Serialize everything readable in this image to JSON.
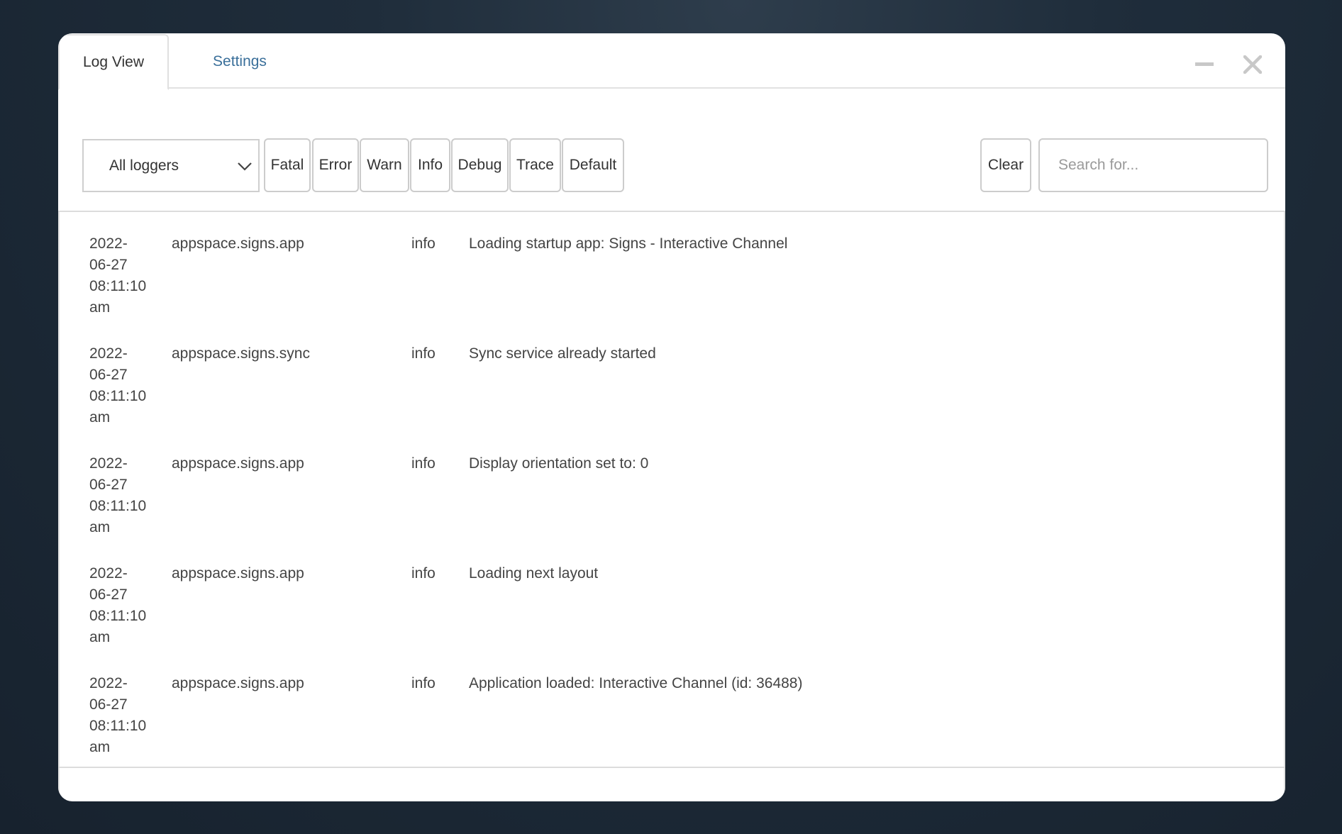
{
  "tabs": {
    "log_view": "Log View",
    "settings": "Settings"
  },
  "window_controls": [
    "minimize-icon",
    "close-icon"
  ],
  "toolbar": {
    "logger_select": "All loggers",
    "levels": [
      "Fatal",
      "Error",
      "Warn",
      "Info",
      "Debug",
      "Trace",
      "Default"
    ],
    "clear": "Clear",
    "search_placeholder": "Search for..."
  },
  "logs": [
    {
      "date": "2022-",
      "date2": "06-27",
      "time": "08:11:10",
      "ampm": "am",
      "logger": "appspace.signs.app",
      "level": "info",
      "message": "Loading startup app: Signs - Interactive Channel"
    },
    {
      "date": "2022-",
      "date2": "06-27",
      "time": "08:11:10",
      "ampm": "am",
      "logger": "appspace.signs.sync",
      "level": "info",
      "message": "Sync service already started"
    },
    {
      "date": "2022-",
      "date2": "06-27",
      "time": "08:11:10",
      "ampm": "am",
      "logger": "appspace.signs.app",
      "level": "info",
      "message": "Display orientation set to: 0"
    },
    {
      "date": "2022-",
      "date2": "06-27",
      "time": "08:11:10",
      "ampm": "am",
      "logger": "appspace.signs.app",
      "level": "info",
      "message": "Loading next layout"
    },
    {
      "date": "2022-",
      "date2": "06-27",
      "time": "08:11:10",
      "ampm": "am",
      "logger": "appspace.signs.app",
      "level": "info",
      "message": "Application loaded: Interactive Channel (id: 36488)"
    }
  ],
  "colors": {
    "tab_active_text": "#333333",
    "tab_link": "#3a6f9a",
    "window_control": "#c8c8c8"
  }
}
